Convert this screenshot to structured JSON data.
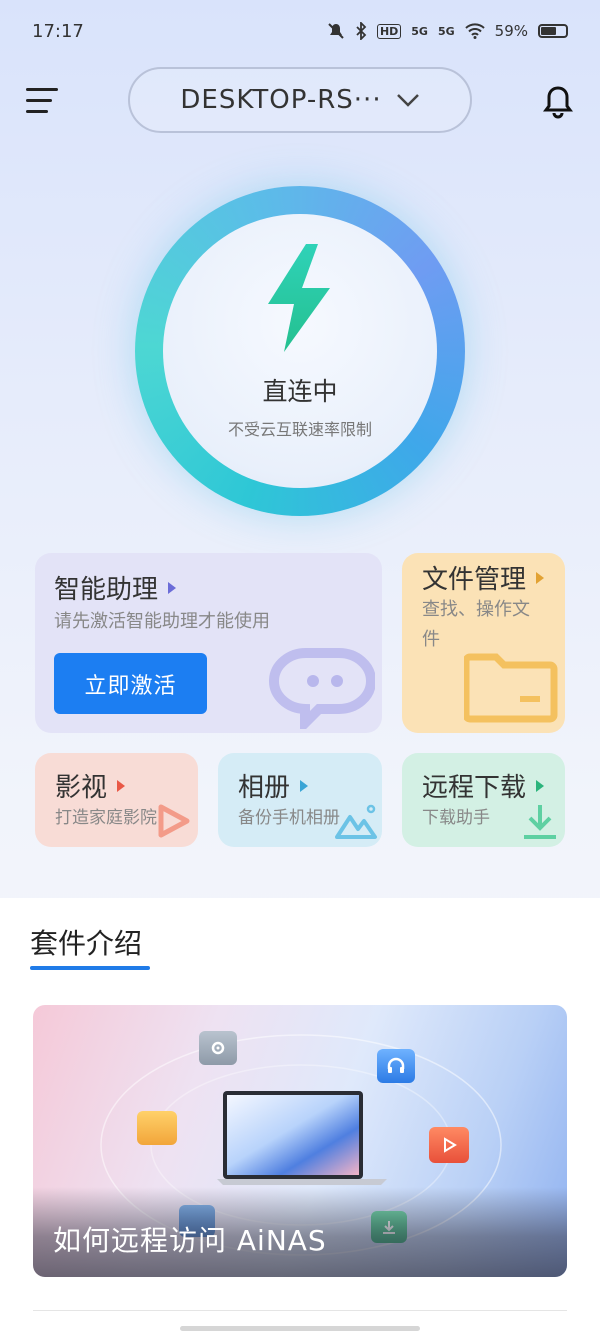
{
  "status_bar": {
    "time": "17:17",
    "battery": "59%",
    "icons": [
      "mute-icon",
      "bluetooth-icon",
      "hd-icon",
      "signal-5g-icon",
      "signal-5g-icon",
      "wifi-icon",
      "battery-icon"
    ],
    "hd_label": "HD",
    "net1": "5G",
    "net2": "5G"
  },
  "header": {
    "device_name": "DESKTOP-RS···",
    "menu_icon": "menu-icon",
    "bell_icon": "bell-icon"
  },
  "connection": {
    "status": "直连中",
    "subtitle": "不受云互联速率限制",
    "icon": "lightning-bolt-icon"
  },
  "cards": {
    "assistant": {
      "title": "智能助理",
      "desc": "请先激活智能助理才能使用",
      "button": "立即激活"
    },
    "files": {
      "title": "文件管理",
      "desc_line1": "查找、操作文",
      "desc_line2": "件"
    },
    "video": {
      "title": "影视",
      "desc": "打造家庭影院"
    },
    "photo": {
      "title": "相册",
      "desc": "备份手机相册"
    },
    "download": {
      "title": "远程下载",
      "desc": "下载助手"
    }
  },
  "suite": {
    "title": "套件介绍",
    "banner_caption": "如何远程访问 AiNAS"
  },
  "colors": {
    "accent": "#1c7ef2",
    "assistant_bg": "#e3e3f7",
    "files_bg": "#fbe2b6",
    "video_bg": "#f8dcd6",
    "photo_bg": "#d5ecf6",
    "download_bg": "#d3f0e4"
  }
}
